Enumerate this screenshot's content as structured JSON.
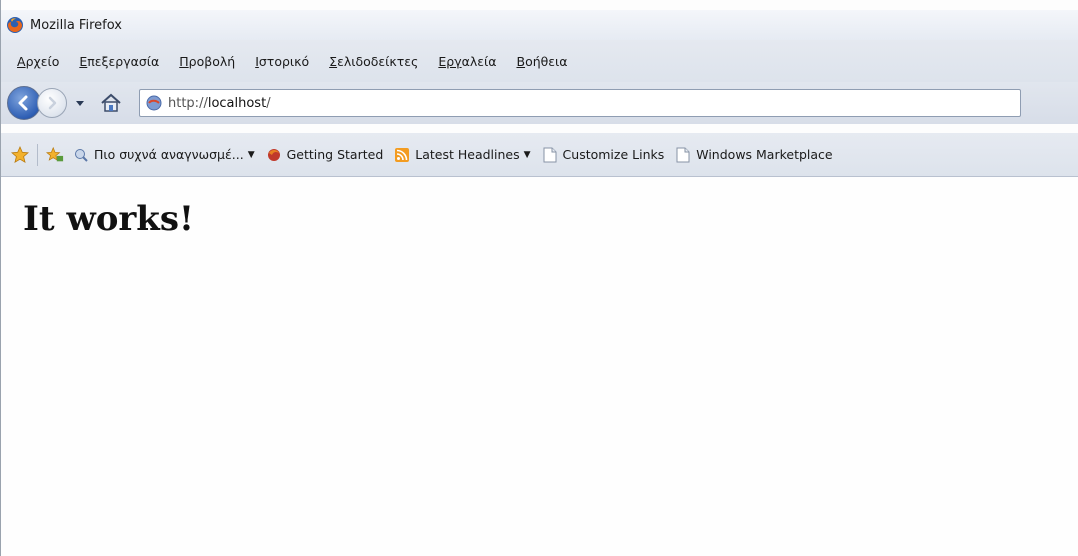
{
  "window": {
    "title": "Mozilla Firefox"
  },
  "menu": {
    "items": [
      {
        "label": "Αρχείο",
        "mnemonic": "Α",
        "rest": "ρχείο"
      },
      {
        "label": "Επεξεργασία",
        "mnemonic": "Ε",
        "rest": "πεξεργασία"
      },
      {
        "label": "Προβολή",
        "mnemonic": "Π",
        "rest": "ροβολή"
      },
      {
        "label": "Ιστορικό",
        "mnemonic": "Ι",
        "rest": "στορικό"
      },
      {
        "label": "Σελιδοδείκτες",
        "mnemonic": "Σ",
        "rest": "ελιδοδείκτες"
      },
      {
        "label": "Εργαλεία",
        "mnemonic": "Εργ",
        "rest": "αλεία",
        "prefix_plain": true
      },
      {
        "label": "Βοήθεια",
        "mnemonic": "Β",
        "rest": "οήθεια"
      }
    ]
  },
  "navbar": {
    "url_prefix": "http://",
    "url_host": "localhost",
    "url_suffix": "/"
  },
  "bookmarks": {
    "items": [
      {
        "label": "Πιο συχνά αναγνωσμέ...",
        "icon": "most-visited-icon",
        "dropdown": true
      },
      {
        "label": "Getting Started",
        "icon": "firefox-icon",
        "dropdown": false
      },
      {
        "label": "Latest Headlines",
        "icon": "rss-feed-icon",
        "dropdown": true
      },
      {
        "label": "Customize Links",
        "icon": "page-icon",
        "dropdown": false
      },
      {
        "label": "Windows Marketplace",
        "icon": "page-icon",
        "dropdown": false
      }
    ]
  },
  "page": {
    "heading": "It works!"
  },
  "colors": {
    "accent": "#2f5fb4",
    "toolbar": "#dde3ec"
  }
}
